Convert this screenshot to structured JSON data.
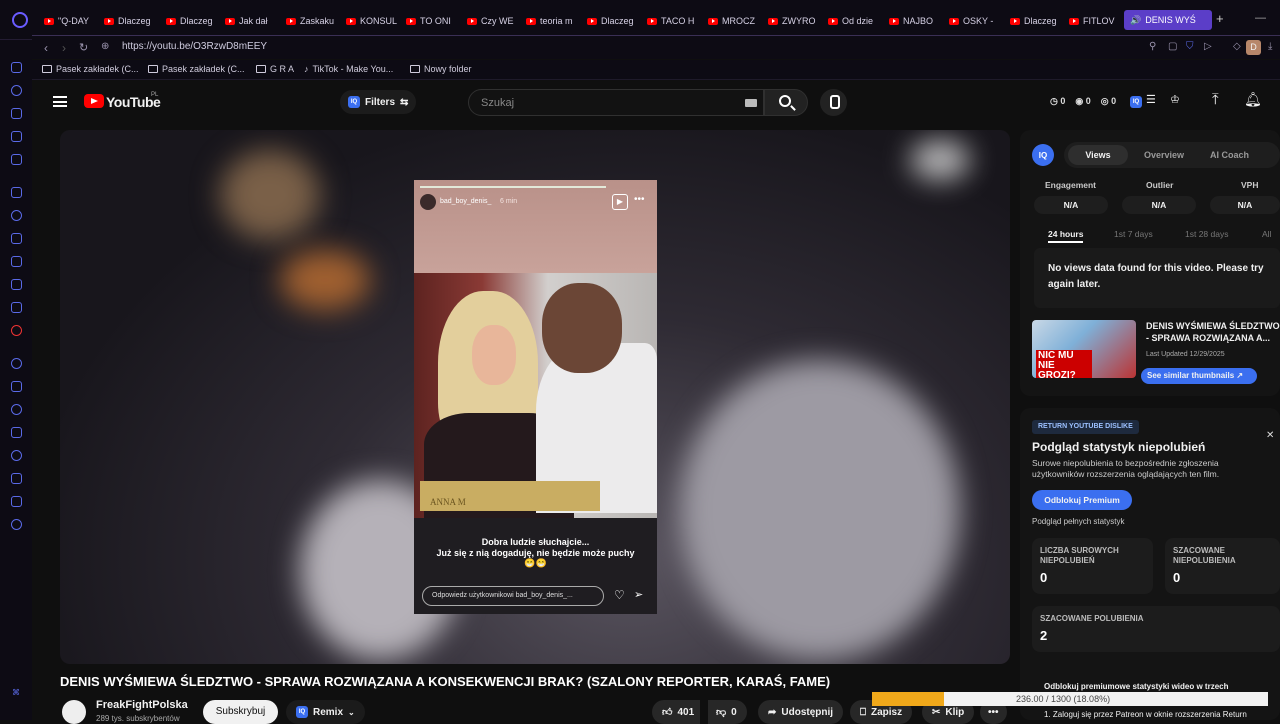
{
  "browser": {
    "tabs": [
      "\"Q-DAY",
      "Dlaczeg",
      "Dlaczeg",
      "Jak dał",
      "Zaskaku",
      "KONSUL",
      "TO ONI",
      "Czy WE",
      "teoria m",
      "Dlaczeg",
      "TACO H",
      "MROCZ",
      "ZWYRO",
      "Od dzie",
      "NAJBO",
      "OSKY -",
      "Dlaczeg",
      "FITLOV"
    ],
    "active_tab": "DENIS WYŚ",
    "url": "https://youtu.be/O3RzwD8mEEY",
    "profile_initial": "D",
    "bookmarks": [
      "Pasek zakładek (C...",
      "Pasek zakładek (C...",
      "G R A",
      "TikTok - Make You...",
      "Nowy folder"
    ]
  },
  "youtube": {
    "logo_text": "YouTube",
    "region": "PL",
    "filters_label": "Filters",
    "iq_label": "IQ",
    "search_placeholder": "Szukaj",
    "stats": [
      "0",
      "0",
      "0"
    ]
  },
  "story": {
    "username": "bad_boy_denis_",
    "age": "6 min",
    "caption_line1": "Dobra ludzie słuchajcie...",
    "caption_line2": "Już się z nią dogaduję, nie będzie może puchy",
    "emoji": "😁😁",
    "reply_placeholder": "Odpowiedz użytkownikowi bad_boy_denis_...",
    "plaque_text": "ANNA M"
  },
  "video": {
    "title": "DENIS WYŚMIEWA ŚLEDZTWO - SPRAWA ROZWIĄZANA A KONSEKWENCJI BRAK? (SZALONY REPORTER, KARAŚ, FAME)",
    "channel": "FreakFightPolska",
    "subscribers": "289 tys. subskrybentów",
    "subscribe_label": "Subskrybuj",
    "remix_label": "Remix",
    "likes": "401",
    "dislikes": "0",
    "share_label": "Udostępnij",
    "save_label": "Zapisz",
    "clip_label": "Klip"
  },
  "iq_panel": {
    "tabs": [
      "Views",
      "Overview",
      "AI Coach"
    ],
    "metrics": [
      {
        "label": "Engagement",
        "value": "N/A"
      },
      {
        "label": "Outlier",
        "value": "N/A"
      },
      {
        "label": "VPH",
        "value": "N/A"
      }
    ],
    "ranges": [
      "24 hours",
      "1st 7 days",
      "1st 28 days",
      "All"
    ],
    "no_data_msg": "No views data found for this video. Please try again later.",
    "thumb_title": "DENIS WYŚMIEWA ŚLEDZTWO - SPRAWA ROZWIĄZANA A...",
    "thumb_updated": "Last Updated 12/29/2025",
    "thumb_text": "NIC MU NIE GROZI?",
    "similar_btn": "See similar thumbnails"
  },
  "rytd": {
    "badge": "RETURN YOUTUBE DISLIKE",
    "heading": "Podgląd statystyk niepolubień",
    "desc": "Surowe niepolubienia to bezpośrednie zgłoszenia użytkowników rozszerzenia oglądających ten film.",
    "unlock_btn": "Odblokuj Premium",
    "preview_note": "Podgląd pełnych statystyk",
    "raw_label": "LICZBA SUROWYCH NIEPOLUBIEŃ",
    "raw_value": "0",
    "est_dislikes_label": "SZACOWANE NIEPOLUBIENIA",
    "est_dislikes_value": "0",
    "est_likes_label": "SZACOWANE POLUBIENIA",
    "est_likes_value": "2",
    "footer1": "Odblokuj premiumowe statystyki wideo w trzech",
    "footer2": "1. Zaloguj się przez Patreon w oknie rozszerzenia Return",
    "overlay_counter": "236.00 / 1300 (18.08%)",
    "overlay_progress": 0.1808
  },
  "colors": {
    "accent": "#3b6ff0",
    "yt_red": "#ff0000",
    "browser_accent": "#5b3ec8"
  }
}
